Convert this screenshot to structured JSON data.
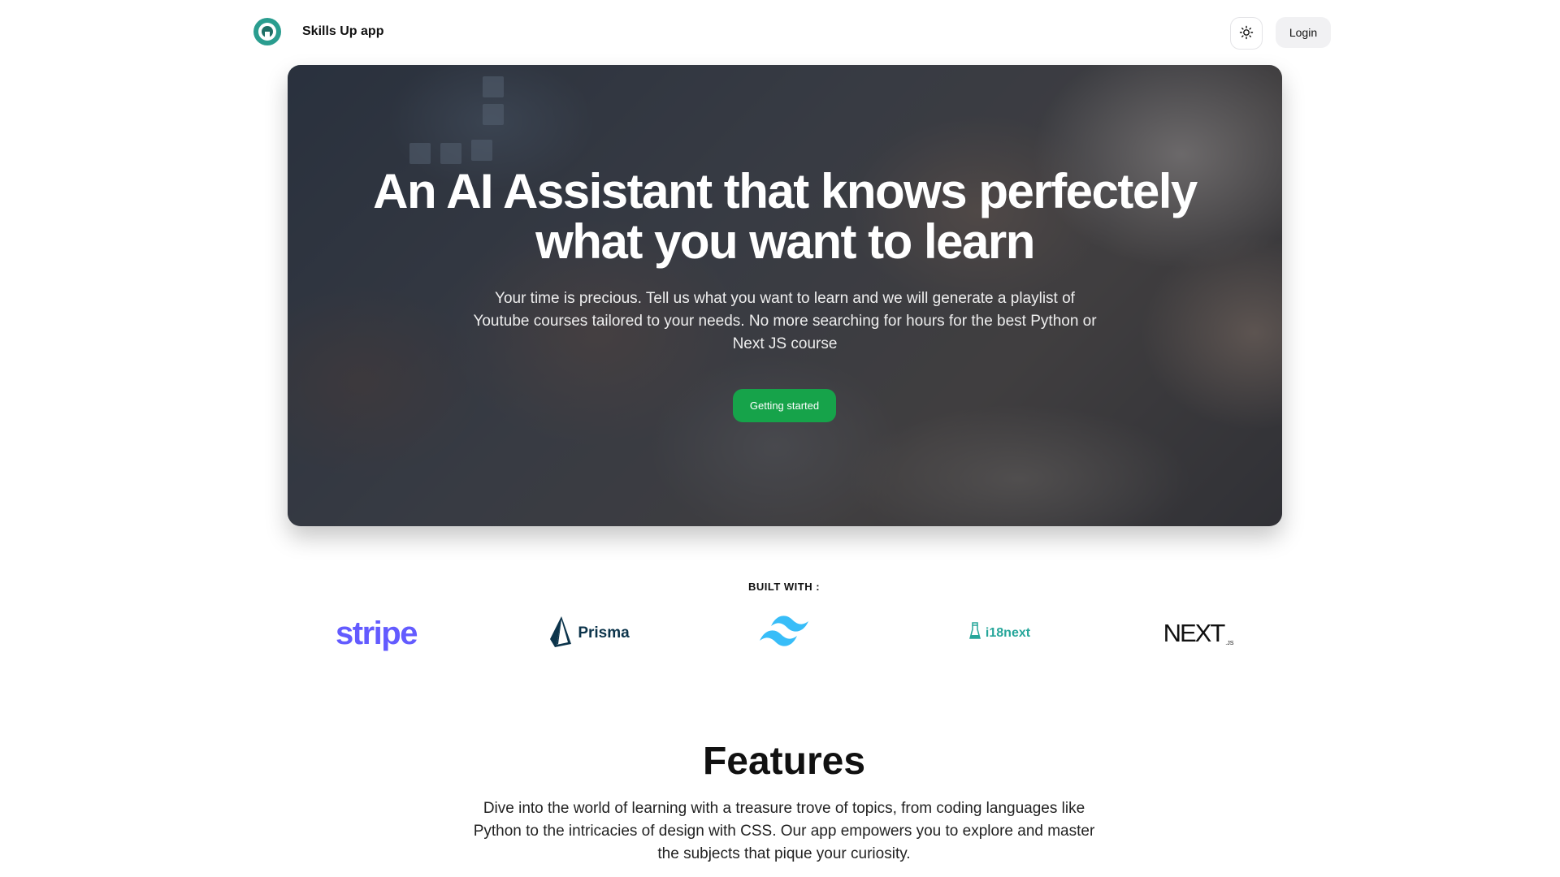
{
  "header": {
    "brand": "Skills Up app",
    "login_label": "Login",
    "logo_icon": "skills-up-logo",
    "theme_icon": "sun-icon",
    "brand_color": "#2a9d8f"
  },
  "hero": {
    "title": "An AI Assistant that knows perfectely what you want to learn",
    "subtitle": "Your time is precious. Tell us what you want to learn and we will generate a playlist of Youtube courses tailored to your needs. No more searching for hours for the best Python or Next JS course",
    "cta_label": "Getting started",
    "cta_color": "#16a34a"
  },
  "built_with": {
    "label": "BUILT WITH :",
    "logos": [
      {
        "name": "stripe",
        "text": "stripe",
        "color": "#635bff"
      },
      {
        "name": "prisma",
        "text": "Prisma",
        "color": "#0c344b"
      },
      {
        "name": "tailwind",
        "text": "",
        "color": "#38bdf8"
      },
      {
        "name": "i18next",
        "text": "i18next",
        "color": "#26a69a"
      },
      {
        "name": "nextjs",
        "text": "NEXT",
        "suffix": ".JS",
        "color": "#111111"
      }
    ]
  },
  "features": {
    "title": "Features",
    "text": "Dive into the world of learning with a treasure trove of topics, from coding languages like Python to the intricacies of design with CSS. Our app empowers you to explore and master the subjects that pique your curiosity."
  }
}
